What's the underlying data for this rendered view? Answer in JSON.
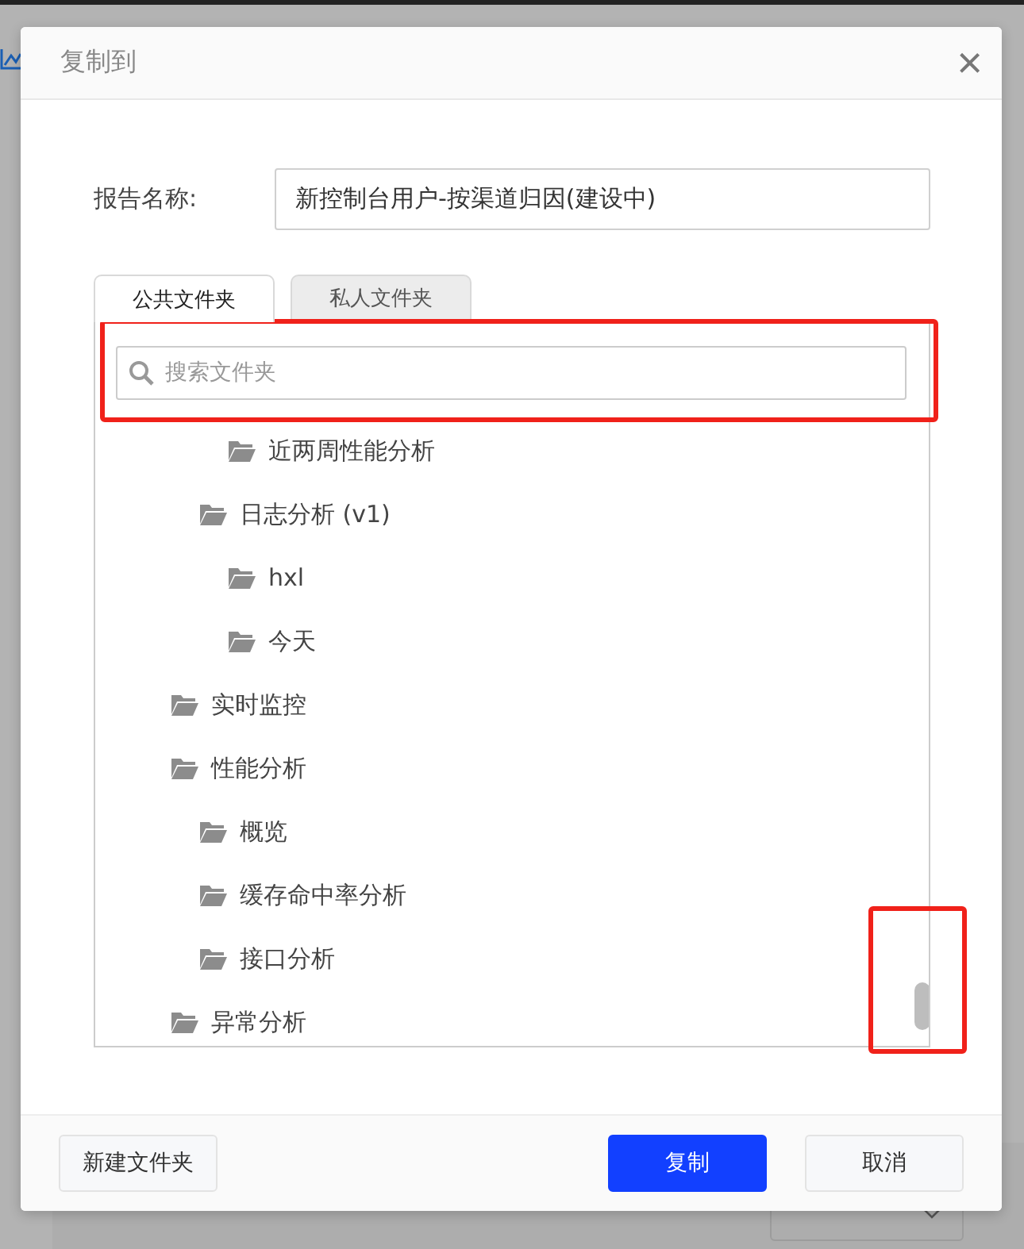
{
  "dialog": {
    "title": "复制到",
    "close": "×"
  },
  "report_name": {
    "label": "报告名称:",
    "value": "新控制台用户-按渠道归因(建设中)"
  },
  "tabs": [
    {
      "label": "公共文件夹",
      "selected": true
    },
    {
      "label": "私人文件夹",
      "selected": false
    }
  ],
  "search": {
    "placeholder": "搜索文件夹"
  },
  "folders": [
    {
      "children": [
        {
          "children": [
            {
              "name": "近两周性能分析"
            }
          ]
        },
        {
          "name": "日志分析 (v1)",
          "children": [
            {
              "name": "hxl"
            },
            {
              "name": "今天"
            }
          ]
        }
      ]
    },
    {
      "name": "实时监控"
    },
    {
      "name": "性能分析",
      "children": [
        {
          "name": "概览"
        },
        {
          "name": "缓存命中率分析"
        },
        {
          "name": "接口分析"
        }
      ]
    },
    {
      "name": "异常分析"
    }
  ],
  "buttons": {
    "new_folder": "新建文件夹",
    "confirm": "复制",
    "cancel": "取消"
  }
}
